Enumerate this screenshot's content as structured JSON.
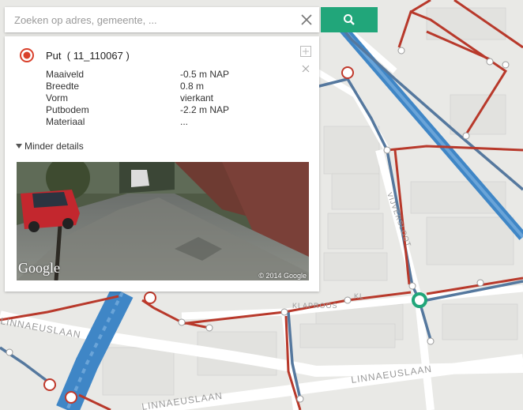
{
  "search": {
    "placeholder": "Zoeken op adres, gemeente, ...",
    "value": ""
  },
  "icons": {
    "clear": "close-icon",
    "search": "search-icon",
    "selected": "radio-selected-icon",
    "expand": "expand-icon",
    "close": "close-icon",
    "details": "caret-down-icon"
  },
  "colors": {
    "accent": "#21a67a",
    "sewer_red": "#c0392b",
    "sewer_blue": "#55789e",
    "water": "#4a8fc8",
    "selected_node": "#21a67a"
  },
  "feature": {
    "type": "Put",
    "id": "( 11_110067 )",
    "attributes": [
      {
        "key": "Maaiveld",
        "value": "-0.5 m NAP"
      },
      {
        "key": "Breedte",
        "value": "0.8 m"
      },
      {
        "key": "Vorm",
        "value": "vierkant"
      },
      {
        "key": "Putbodem",
        "value": "-2.2 m NAP"
      },
      {
        "key": "Materiaal",
        "value": "..."
      }
    ],
    "details_toggle": "Minder details"
  },
  "streetview": {
    "logo": "Google",
    "copyright": "© 2014 Google"
  },
  "map": {
    "street_labels": [
      "LINNAEUSLAAN",
      "LINNAEUSLAAN",
      "LINNAEUSLAAN",
      "VIJVERSLOOT",
      "KLAPROOS",
      "KL"
    ]
  }
}
